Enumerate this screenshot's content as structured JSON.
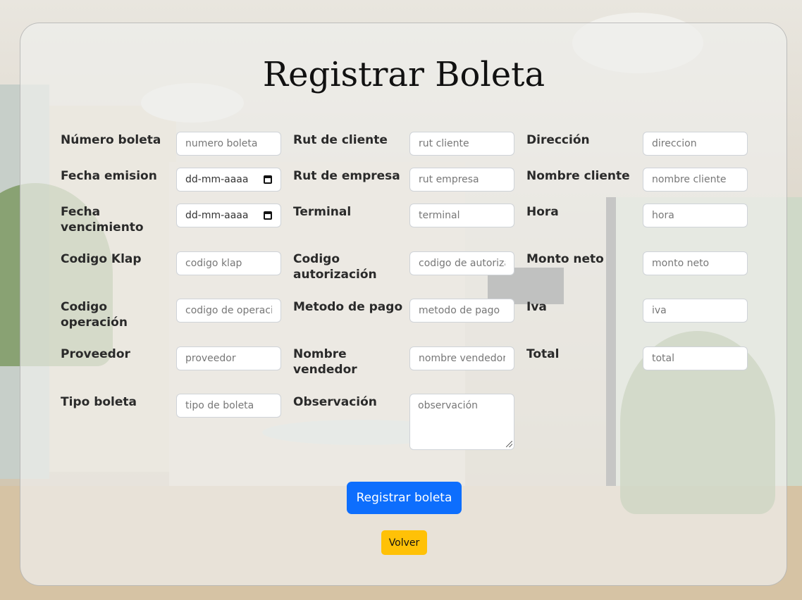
{
  "page": {
    "title": "Registrar Boleta"
  },
  "form": {
    "fields": [
      {
        "label": "Número boleta",
        "placeholder": "numero boleta"
      },
      {
        "label": "Rut de cliente",
        "placeholder": "rut cliente"
      },
      {
        "label": "Dirección",
        "placeholder": "direccion"
      },
      {
        "label": "Fecha emision",
        "value": "dd-mm-aaaa"
      },
      {
        "label": "Rut de empresa",
        "placeholder": "rut empresa"
      },
      {
        "label": "Nombre cliente",
        "placeholder": "nombre cliente"
      },
      {
        "label": "Fecha vencimiento",
        "value": "dd-mm-aaaa"
      },
      {
        "label": "Terminal",
        "placeholder": "terminal"
      },
      {
        "label": "Hora",
        "placeholder": "hora"
      },
      {
        "label": "Codigo Klap",
        "placeholder": "codigo klap"
      },
      {
        "label": "Codigo autorización",
        "placeholder": "codigo de autorización"
      },
      {
        "label": "Monto neto",
        "placeholder": "monto neto"
      },
      {
        "label": "Codigo operación",
        "placeholder": "codigo de operación"
      },
      {
        "label": "Metodo de pago",
        "placeholder": "metodo de pago"
      },
      {
        "label": "Iva",
        "placeholder": "iva"
      },
      {
        "label": "Proveedor",
        "placeholder": "proveedor"
      },
      {
        "label": "Nombre vendedor",
        "placeholder": "nombre vendedor"
      },
      {
        "label": "Total",
        "placeholder": "total"
      },
      {
        "label": "Tipo boleta",
        "placeholder": "tipo de boleta"
      },
      {
        "label": "Observación",
        "placeholder": "observación"
      }
    ]
  },
  "buttons": {
    "submit": "Registrar boleta",
    "back": "Volver"
  },
  "colors": {
    "primary": "#0d6efd",
    "warning": "#ffc107"
  },
  "icons": {
    "date": "calendar-icon"
  }
}
